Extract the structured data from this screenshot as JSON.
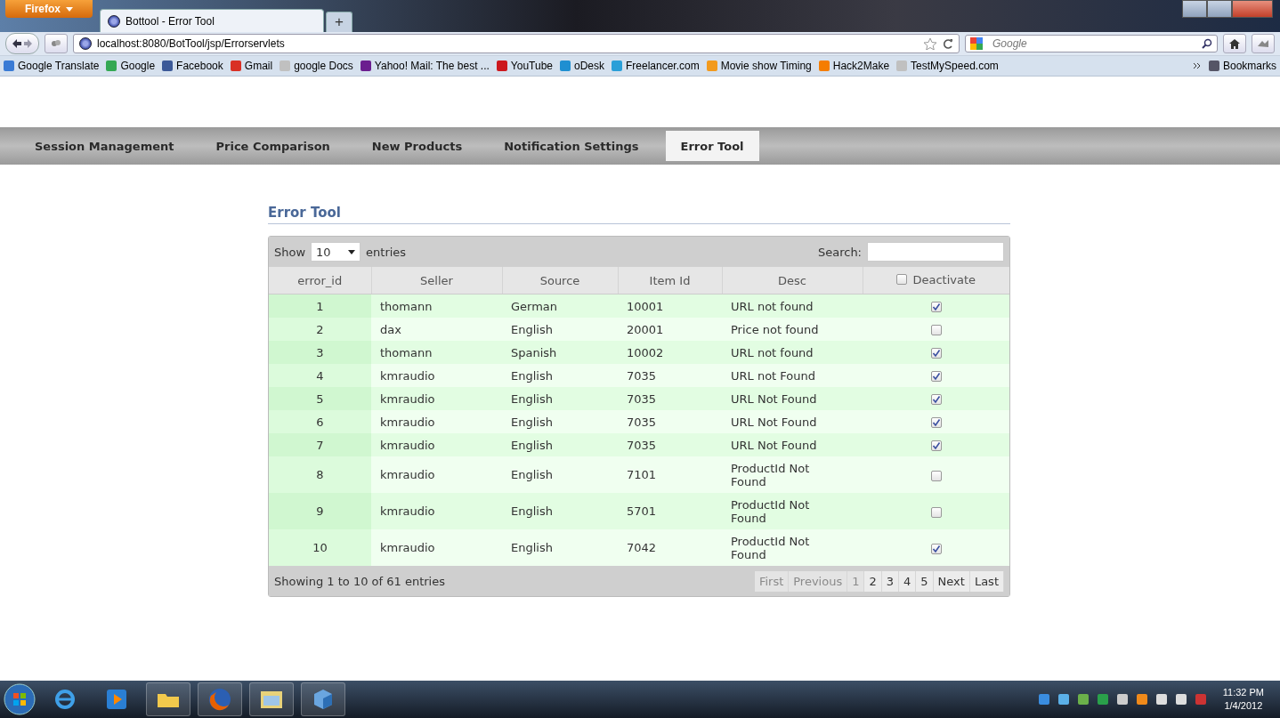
{
  "browser": {
    "menu_button": "Firefox",
    "tabs": [
      {
        "title": "Bottool - Error Tool",
        "selected": true
      }
    ],
    "new_tab": "+",
    "address": "localhost:8080/BotTool/jsp/Errorservlets",
    "search_placeholder": "Google",
    "bookmarks": [
      {
        "label": "Google Translate",
        "color": "#3a7bd5"
      },
      {
        "label": "Google",
        "color": "#34a853"
      },
      {
        "label": "Facebook",
        "color": "#3b5998"
      },
      {
        "label": "Gmail",
        "color": "#d93025"
      },
      {
        "label": "google Docs",
        "color": "#c0c0c0"
      },
      {
        "label": "Yahoo! Mail: The best ...",
        "color": "#6b1e8f"
      },
      {
        "label": "YouTube",
        "color": "#cc181e"
      },
      {
        "label": "oDesk",
        "color": "#1f8fd1"
      },
      {
        "label": "Freelancer.com",
        "color": "#2a9fd8"
      },
      {
        "label": "Movie show Timing",
        "color": "#f29a1d"
      },
      {
        "label": "Hack2Make",
        "color": "#f57d00"
      },
      {
        "label": "TestMySpeed.com",
        "color": "#c0c0c0"
      }
    ],
    "bookmarks_menu": "Bookmarks"
  },
  "nav": [
    {
      "label": "Session Management",
      "selected": false
    },
    {
      "label": "Price Comparison",
      "selected": false
    },
    {
      "label": "New Products",
      "selected": false
    },
    {
      "label": "Notification Settings",
      "selected": false
    },
    {
      "label": "Error Tool",
      "selected": true
    }
  ],
  "panel": {
    "title": "Error Tool",
    "show_label": "Show",
    "page_size": "10",
    "entries_label": "entries",
    "search_label": "Search:",
    "columns": [
      "error_id",
      "Seller",
      "Source",
      "Item Id",
      "Desc",
      "Deactivate"
    ],
    "deactivate_all": false,
    "rows": [
      {
        "error_id": "1",
        "seller": "thomann",
        "source": "German",
        "item_id": "10001",
        "desc": "URL not found",
        "deactivated": true
      },
      {
        "error_id": "2",
        "seller": "dax",
        "source": "English",
        "item_id": "20001",
        "desc": "Price not found",
        "deactivated": false
      },
      {
        "error_id": "3",
        "seller": "thomann",
        "source": "Spanish",
        "item_id": "10002",
        "desc": "URL not found",
        "deactivated": true
      },
      {
        "error_id": "4",
        "seller": "kmraudio",
        "source": "English",
        "item_id": "7035",
        "desc": "URL not Found",
        "deactivated": true
      },
      {
        "error_id": "5",
        "seller": "kmraudio",
        "source": "English",
        "item_id": "7035",
        "desc": "URL Not Found",
        "deactivated": true
      },
      {
        "error_id": "6",
        "seller": "kmraudio",
        "source": "English",
        "item_id": "7035",
        "desc": "URL Not Found",
        "deactivated": true
      },
      {
        "error_id": "7",
        "seller": "kmraudio",
        "source": "English",
        "item_id": "7035",
        "desc": "URL Not Found",
        "deactivated": true
      },
      {
        "error_id": "8",
        "seller": "kmraudio",
        "source": "English",
        "item_id": "7101",
        "desc": "ProductId Not Found",
        "deactivated": false
      },
      {
        "error_id": "9",
        "seller": "kmraudio",
        "source": "English",
        "item_id": "5701",
        "desc": "ProductId Not Found",
        "deactivated": false
      },
      {
        "error_id": "10",
        "seller": "kmraudio",
        "source": "English",
        "item_id": "7042",
        "desc": "ProductId Not Found",
        "deactivated": true
      }
    ],
    "info": "Showing 1 to 10 of 61 entries",
    "pagination": [
      {
        "label": "First",
        "disabled": true
      },
      {
        "label": "Previous",
        "disabled": true
      },
      {
        "label": "1",
        "disabled": true
      },
      {
        "label": "2",
        "disabled": false
      },
      {
        "label": "3",
        "disabled": false
      },
      {
        "label": "4",
        "disabled": false
      },
      {
        "label": "5",
        "disabled": false
      },
      {
        "label": "Next",
        "disabled": false
      },
      {
        "label": "Last",
        "disabled": false
      }
    ]
  },
  "taskbar": {
    "clock_time": "11:32 PM",
    "clock_date": "1/4/2012"
  }
}
